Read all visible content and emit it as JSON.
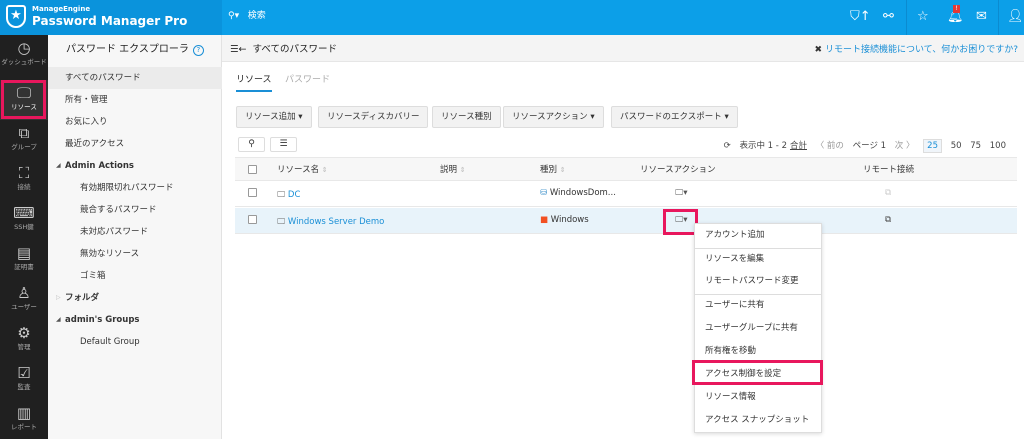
{
  "app": {
    "brand": "ManageEngine",
    "product": "Password Manager Pro",
    "search_placeholder": "検索",
    "notification_badge": "!"
  },
  "nav": [
    {
      "label": "ダッシュボード",
      "icon": "dashboard-icon"
    },
    {
      "label": "リソース",
      "icon": "monitor-icon",
      "active": true
    },
    {
      "label": "グループ",
      "icon": "group-icon"
    },
    {
      "label": "接続",
      "icon": "connection-icon"
    },
    {
      "label": "SSH鍵",
      "icon": "ssh-key-icon"
    },
    {
      "label": "証明書",
      "icon": "certificate-icon"
    },
    {
      "label": "ユーザー",
      "icon": "user-icon"
    },
    {
      "label": "管理",
      "icon": "gear-icon"
    },
    {
      "label": "監査",
      "icon": "audit-icon"
    },
    {
      "label": "レポート",
      "icon": "report-icon"
    }
  ],
  "explorer": {
    "title": "パスワード エクスプローラ",
    "help": "?",
    "items": [
      "すべてのパスワード",
      "所有・管理",
      "お気に入り",
      "最近のアクセス"
    ],
    "admin_actions": {
      "label": "Admin Actions",
      "items": [
        "有効期限切れパスワード",
        "競合するパスワード",
        "未対応パスワード",
        "無効なリソース",
        "ゴミ箱"
      ]
    },
    "folder": "フォルダ",
    "groups": {
      "label": "admin's Groups",
      "items": [
        "Default Group"
      ]
    }
  },
  "main": {
    "title": "すべてのパスワード",
    "help_link": "リモート接続機能について、何かお困りですか?",
    "tabs": [
      "リソース",
      "パスワード"
    ],
    "buttons": [
      "リソース追加",
      "リソースディスカバリー",
      "リソース種別",
      "リソースアクション",
      "パスワードのエクスポート"
    ],
    "pager": {
      "showing": "表示中 1 - 2",
      "total": "合計",
      "prev": "〈 前の",
      "page": "ページ 1",
      "next": "次 〉",
      "sizes": [
        "25",
        "50",
        "75",
        "100"
      ],
      "selected": "25"
    },
    "columns": [
      "リソース名",
      "説明",
      "種別",
      "リソースアクション",
      "リモート接続"
    ],
    "rows": [
      {
        "name": "DC",
        "description": "",
        "type": "WindowsDom..."
      },
      {
        "name": "Windows Server Demo",
        "description": "",
        "type": "Windows"
      }
    ]
  },
  "menu": [
    "アカウント追加",
    "リソースを編集",
    "リモートパスワード変更",
    "ユーザーに共有",
    "ユーザーグループに共有",
    "所有権を移動",
    "アクセス制御を設定",
    "リソース情報",
    "アクセス スナップショット"
  ],
  "colors": {
    "topbar": "#0c9fe8",
    "nav": "#202020",
    "highlight": "#e8175d",
    "link": "#1a8fd6"
  }
}
